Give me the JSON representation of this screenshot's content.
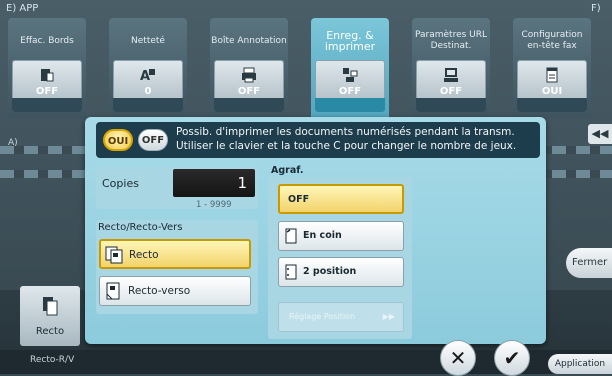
{
  "background": {
    "title_left": "E)  APP",
    "title_right": "F)",
    "section_label": "A)",
    "tabs": [
      {
        "name": "Effac. Bords",
        "value": "OFF",
        "icon": "erase-border-icon"
      },
      {
        "name": "Netteté",
        "value": "0",
        "icon": "sharpness-icon"
      },
      {
        "name": "Boîte Annotation",
        "value": "OFF",
        "icon": "annotation-box-icon"
      },
      {
        "name": "Enreg. & imprimer",
        "value": "OFF",
        "icon": "save-print-icon",
        "active": true
      },
      {
        "name": "Paramètres URL Destinat.",
        "value": "OFF",
        "icon": "url-destination-icon"
      },
      {
        "name": "Configuration en-tête fax",
        "value": "OUI",
        "icon": "fax-header-icon"
      }
    ],
    "right_arrow": "◀◀",
    "fermer_label": "Fermer",
    "recto_button_label": "Recto",
    "bottom_label": "Recto-R/V",
    "application_label": "Application"
  },
  "dialog": {
    "toggle_on_label": "OUI",
    "toggle_off_label": "OFF",
    "notice_line1": "Possib. d'imprimer les documents numérisés pendant la transm.",
    "notice_line2": "Utiliser le clavier et la touche C pour changer le nombre de jeux.",
    "copies_label": "Copies",
    "copies_value": "1",
    "copies_range": "1 - 9999",
    "recto_verso_title": "Recto/Recto-Vers",
    "recto_label": "Recto",
    "recto_verso_label": "Recto-verso",
    "agraf_title": "Agraf.",
    "agraf_off": "OFF",
    "agraf_corner": "En coin",
    "agraf_two": "2 position",
    "agraf_position": "Réglage Position",
    "cancel_symbol": "✕",
    "ok_symbol": "✔"
  },
  "colors": {
    "dialog_bg": "#8ccbdc",
    "notice_bg": "#1e3d4c",
    "selected_bg": "#f2d36a",
    "selected_border": "#c89a00"
  }
}
